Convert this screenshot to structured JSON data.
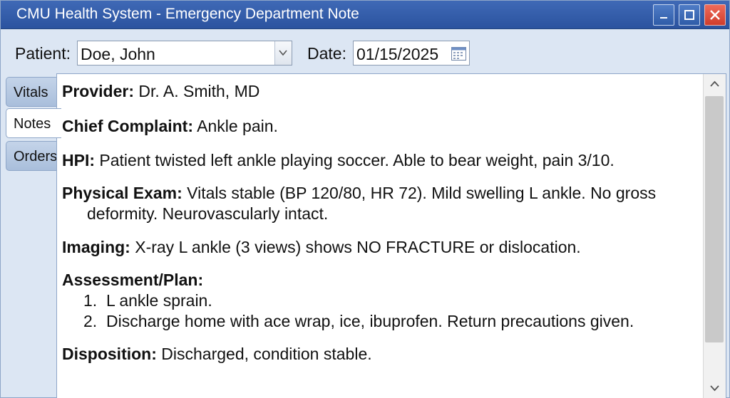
{
  "window": {
    "title": "CMU Health System - Emergency Department Note"
  },
  "toolbar": {
    "patient_label": "Patient:",
    "patient_value": "Doe, John",
    "date_label": "Date:",
    "date_value": "01/15/2025"
  },
  "tabs": [
    {
      "label": "Vitals",
      "selected": false
    },
    {
      "label": "Notes",
      "selected": true
    },
    {
      "label": "Orders",
      "selected": false
    }
  ],
  "note": {
    "provider": {
      "label": "Provider:",
      "text": " Dr. A. Smith, MD"
    },
    "chief_complaint": {
      "label": "Chief Complaint:",
      "text": " Ankle pain."
    },
    "hpi": {
      "label": "HPI:",
      "text": " Patient twisted left ankle playing soccer. Able to bear weight, pain 3/10."
    },
    "physical_exam": {
      "label": "Physical Exam:",
      "text_line1": " Vitals stable (BP 120/80, HR 72). Mild swelling L ankle. No gross",
      "text_line2": "deformity. Neurovascularly intact."
    },
    "imaging": {
      "label": "Imaging:",
      "text": "  X-ray L ankle (3 views) shows NO FRACTURE or dislocation."
    },
    "assessment_plan": {
      "label": "Assessment/Plan:",
      "items": [
        {
          "num": "1.",
          "text": "L ankle sprain."
        },
        {
          "num": "2.",
          "text": "Discharge home with ace wrap, ice, ibuprofen. Return precautions given."
        }
      ]
    },
    "disposition": {
      "label": "Disposition:",
      "text": " Discharged, condition stable."
    }
  },
  "icons": {
    "minimize": "minimize-icon",
    "maximize": "maximize-icon",
    "close": "close-icon",
    "dropdown": "chevron-down-icon",
    "calendar": "calendar-icon",
    "scroll_up": "chevron-up-icon",
    "scroll_down": "chevron-down-icon"
  },
  "colors": {
    "titlebar": "#2f5ca8",
    "close_button": "#cf3d2c",
    "window_bg": "#dce6f3"
  }
}
